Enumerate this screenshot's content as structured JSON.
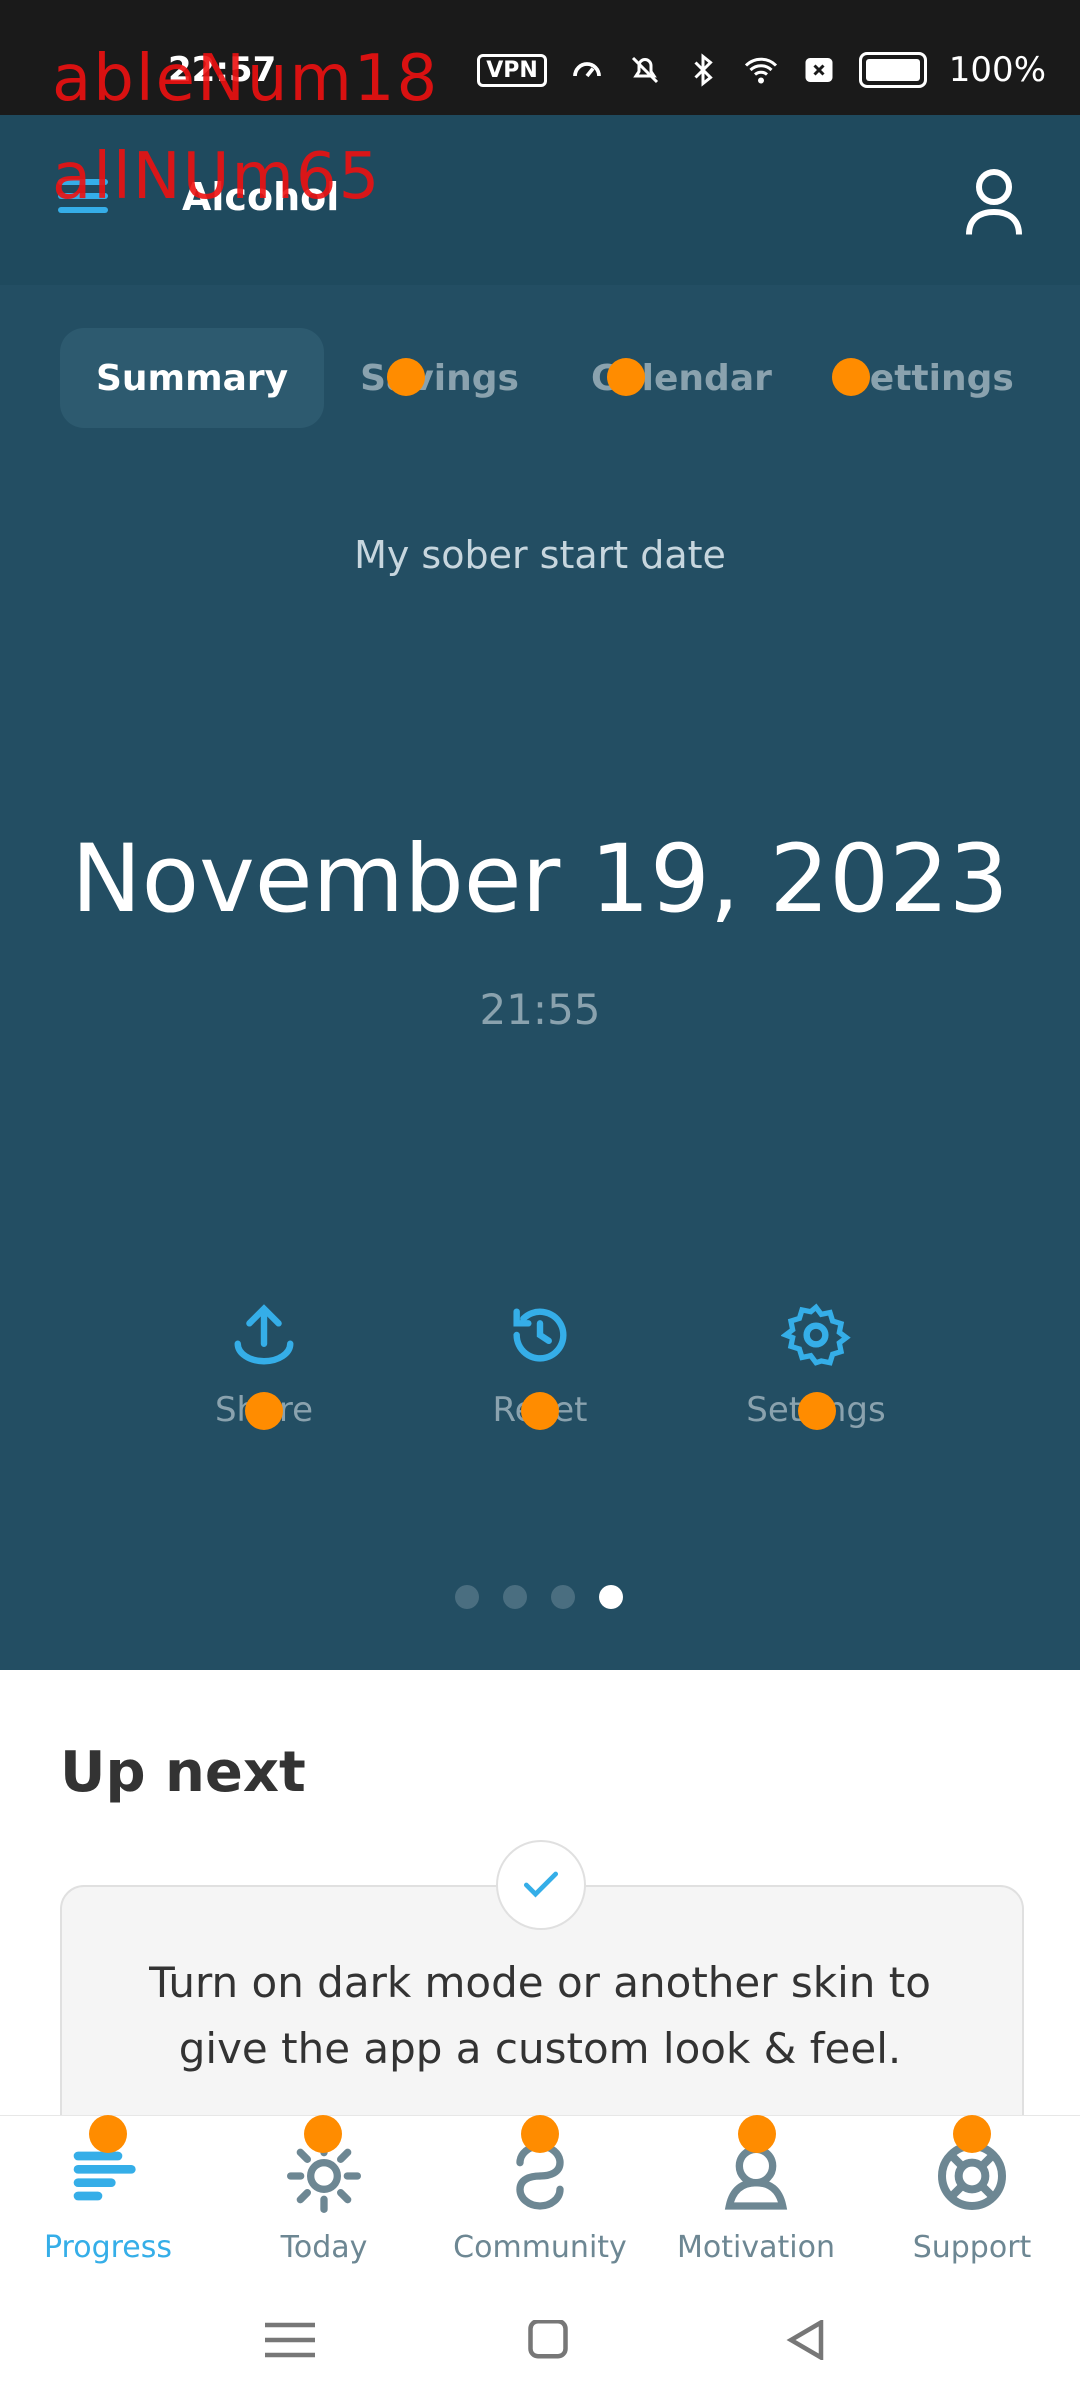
{
  "status_bar": {
    "time": "22:57",
    "battery": "100%",
    "vpn": "VPN"
  },
  "overlay": {
    "line1": "ableNum18",
    "line2": "allNUm65"
  },
  "app_bar": {
    "title": "Alcohol"
  },
  "tabs": [
    {
      "label": "Summary",
      "active": true
    },
    {
      "label": "Savings"
    },
    {
      "label": "Calendar"
    },
    {
      "label": "Settings"
    }
  ],
  "summary": {
    "subtitle": "My sober start date",
    "date": "November 19, 2023",
    "time": "21:55"
  },
  "actions": [
    {
      "label": "Share",
      "icon": "share-icon"
    },
    {
      "label": "Reset",
      "icon": "history-icon"
    },
    {
      "label": "Settings",
      "icon": "gear-icon"
    }
  ],
  "page_indicator": {
    "count": 4,
    "active_index": 3
  },
  "up_next": {
    "title": "Up next",
    "card_text": "Turn on dark mode or another skin to give the app a custom look & feel."
  },
  "bottom_nav": [
    {
      "label": "Progress",
      "icon": "progress-icon",
      "active": true
    },
    {
      "label": "Today",
      "icon": "sun-icon"
    },
    {
      "label": "Community",
      "icon": "community-icon"
    },
    {
      "label": "Motivation",
      "icon": "motivation-icon"
    },
    {
      "label": "Support",
      "icon": "lifebuoy-icon"
    }
  ],
  "colors": {
    "accent": "#35aee8",
    "panel": "#234e63",
    "marker": "#ff8c00"
  }
}
